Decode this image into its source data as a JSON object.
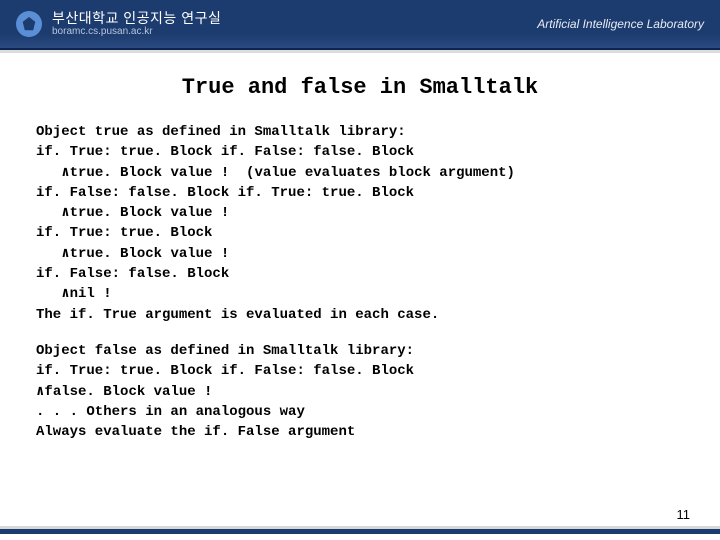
{
  "header": {
    "title": "부산대학교 인공지능 연구실",
    "subtitle": "boramc.cs.pusan.ac.kr",
    "right": "Artificial Intelligence Laboratory"
  },
  "slide_title": "True and false in Smalltalk",
  "block1": "Object true as defined in Smalltalk library:\nif. True: true. Block if. False: false. Block\n   ∧true. Block value !  (value evaluates block argument)\nif. False: false. Block if. True: true. Block\n   ∧true. Block value !\nif. True: true. Block\n   ∧true. Block value !\nif. False: false. Block\n   ∧nil !\nThe if. True argument is evaluated in each case.",
  "block2": "Object false as defined in Smalltalk library:\nif. True: true. Block if. False: false. Block\n∧false. Block value !\n. . . Others in an analogous way\nAlways evaluate the if. False argument",
  "page_number": "11"
}
